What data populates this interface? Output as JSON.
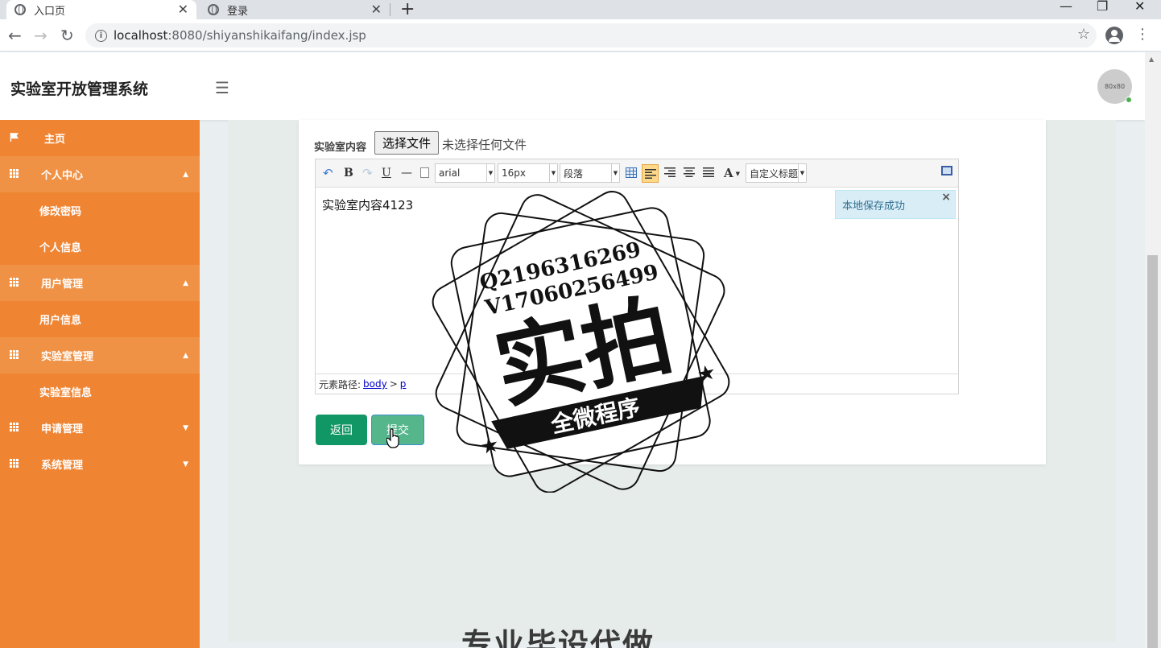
{
  "browser": {
    "tabs": [
      {
        "title": "入口页",
        "active": true
      },
      {
        "title": "登录",
        "active": false
      }
    ],
    "url_host": "localhost",
    "url_path": ":8080/shiyanshikaifang/index.jsp",
    "window_controls": {
      "minimize": "—",
      "restore": "❐",
      "close": "✕"
    }
  },
  "app": {
    "title": "实验室开放管理系统",
    "avatar_text": "80x80"
  },
  "sidebar": {
    "home": "主页",
    "groups": [
      {
        "label": "个人中心",
        "expanded": true,
        "items": [
          "修改密码",
          "个人信息"
        ]
      },
      {
        "label": "用户管理",
        "expanded": true,
        "items": [
          "用户信息"
        ]
      },
      {
        "label": "实验室管理",
        "expanded": true,
        "items": [
          "实验室信息"
        ]
      },
      {
        "label": "申请管理",
        "expanded": false,
        "items": []
      },
      {
        "label": "系统管理",
        "expanded": false,
        "items": []
      }
    ],
    "caret_up": "▲",
    "caret_down": "▼"
  },
  "form": {
    "field_label": "实验室内容",
    "file_button": "选择文件",
    "file_status": "未选择任何文件",
    "editor": {
      "font_family": "arial",
      "font_size": "16px",
      "paragraph": "段落",
      "custom_title": "自定义标题",
      "content": "实验室内容4123",
      "notice": "本地保存成功",
      "path_label": "元素路径:",
      "path_body": "body",
      "path_sep": ">",
      "path_p": "p"
    },
    "back_button": "返回",
    "submit_button": "提交"
  },
  "watermark": {
    "line1": "Q2196316269",
    "line2": "V17060256499",
    "big": "实拍",
    "banner": "全微程序",
    "bottom": "专业毕设代做"
  }
}
